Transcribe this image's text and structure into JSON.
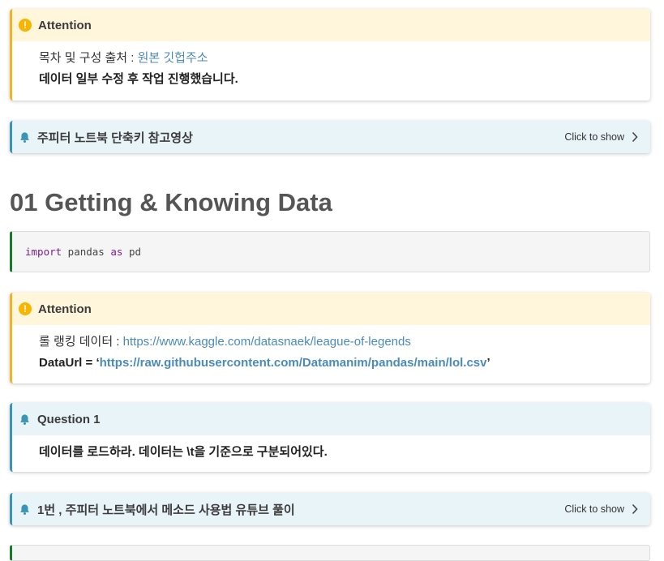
{
  "callout1": {
    "title": "Attention",
    "line1_text": "목차 및 구성 출처 : ",
    "line1_link": "원본 깃헙주소",
    "line2": "데이터 일부 수정 후 작업 진행했습니다."
  },
  "callout2": {
    "title": "주피터 노트북 단축키 참고영상",
    "toggle": "Click to show"
  },
  "heading": "01 Getting & Knowing Data",
  "code": {
    "kw1": "import",
    "mod": " pandas ",
    "kw2": "as",
    "alias": " pd"
  },
  "callout3": {
    "title": "Attention",
    "line1_text": "롤 랭킹 데이터 : ",
    "line1_link": "https://www.kaggle.com/datasnaek/league-of-legends",
    "line2_prefix": "DataUrl = ‘",
    "line2_link": "https://raw.githubusercontent.com/Datamanim/pandas/main/lol.csv",
    "line2_suffix": "’"
  },
  "callout4": {
    "title": "Question 1",
    "body_a": "데이터를 로드하라. 데이터는 ",
    "body_b": "\\t",
    "body_c": "을 기준으로 구분되어있다."
  },
  "callout5": {
    "title": "1번 , 주피터 노트북에서 메소드 사용법 유튜브 풀이",
    "toggle": "Click to show"
  },
  "colors": {
    "warn": "#f0b429",
    "info": "#3a94b4",
    "link": "#4a8bb8",
    "code_border": "#1a7a2a"
  }
}
